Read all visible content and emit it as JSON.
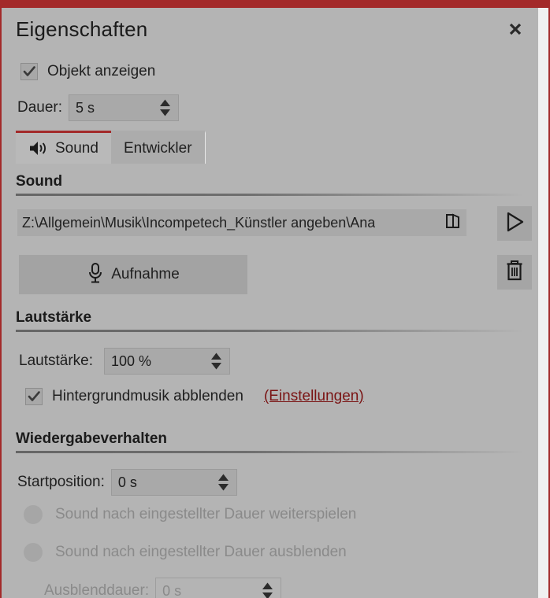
{
  "window": {
    "title": "Eigenschaften",
    "close_icon": "close-icon",
    "accent_color": "#a32a2a",
    "background_color": "#b4b4b4"
  },
  "show_object": {
    "label": "Objekt anzeigen",
    "checked": true,
    "icon": "checkmark-icon"
  },
  "duration": {
    "label": "Dauer:",
    "value": "5 s"
  },
  "tabs": [
    {
      "label": "Sound",
      "icon": "speaker-icon",
      "active": true
    },
    {
      "label": "Entwickler",
      "icon": "",
      "active": false
    }
  ],
  "sound_section": {
    "heading": "Sound",
    "path_value": "Z:\\Allgemein\\Musik\\Incompetech_Künstler angeben\\Ana",
    "browse_icon": "folder-open-icon",
    "play_icon": "play-icon",
    "delete_icon": "trash-icon",
    "record_label": "Aufnahme",
    "record_icon": "microphone-icon"
  },
  "volume_section": {
    "heading": "Lautstärke",
    "volume_label": "Lautstärke:",
    "volume_value": "100 %",
    "fade_label": "Hintergrundmusik abblenden",
    "fade_checked": true,
    "settings_link": "(Einstellungen)",
    "link_color": "#7a1414"
  },
  "playback_section": {
    "heading": "Wiedergabeverhalten",
    "start_label": "Startposition:",
    "start_value": "0 s",
    "option_continue": "Sound nach eingestellter Dauer weiterspielen",
    "option_fadeout": "Sound nach eingestellter Dauer ausblenden",
    "fadeout_label": "Ausblenddauer:",
    "fadeout_value": "0 s"
  }
}
